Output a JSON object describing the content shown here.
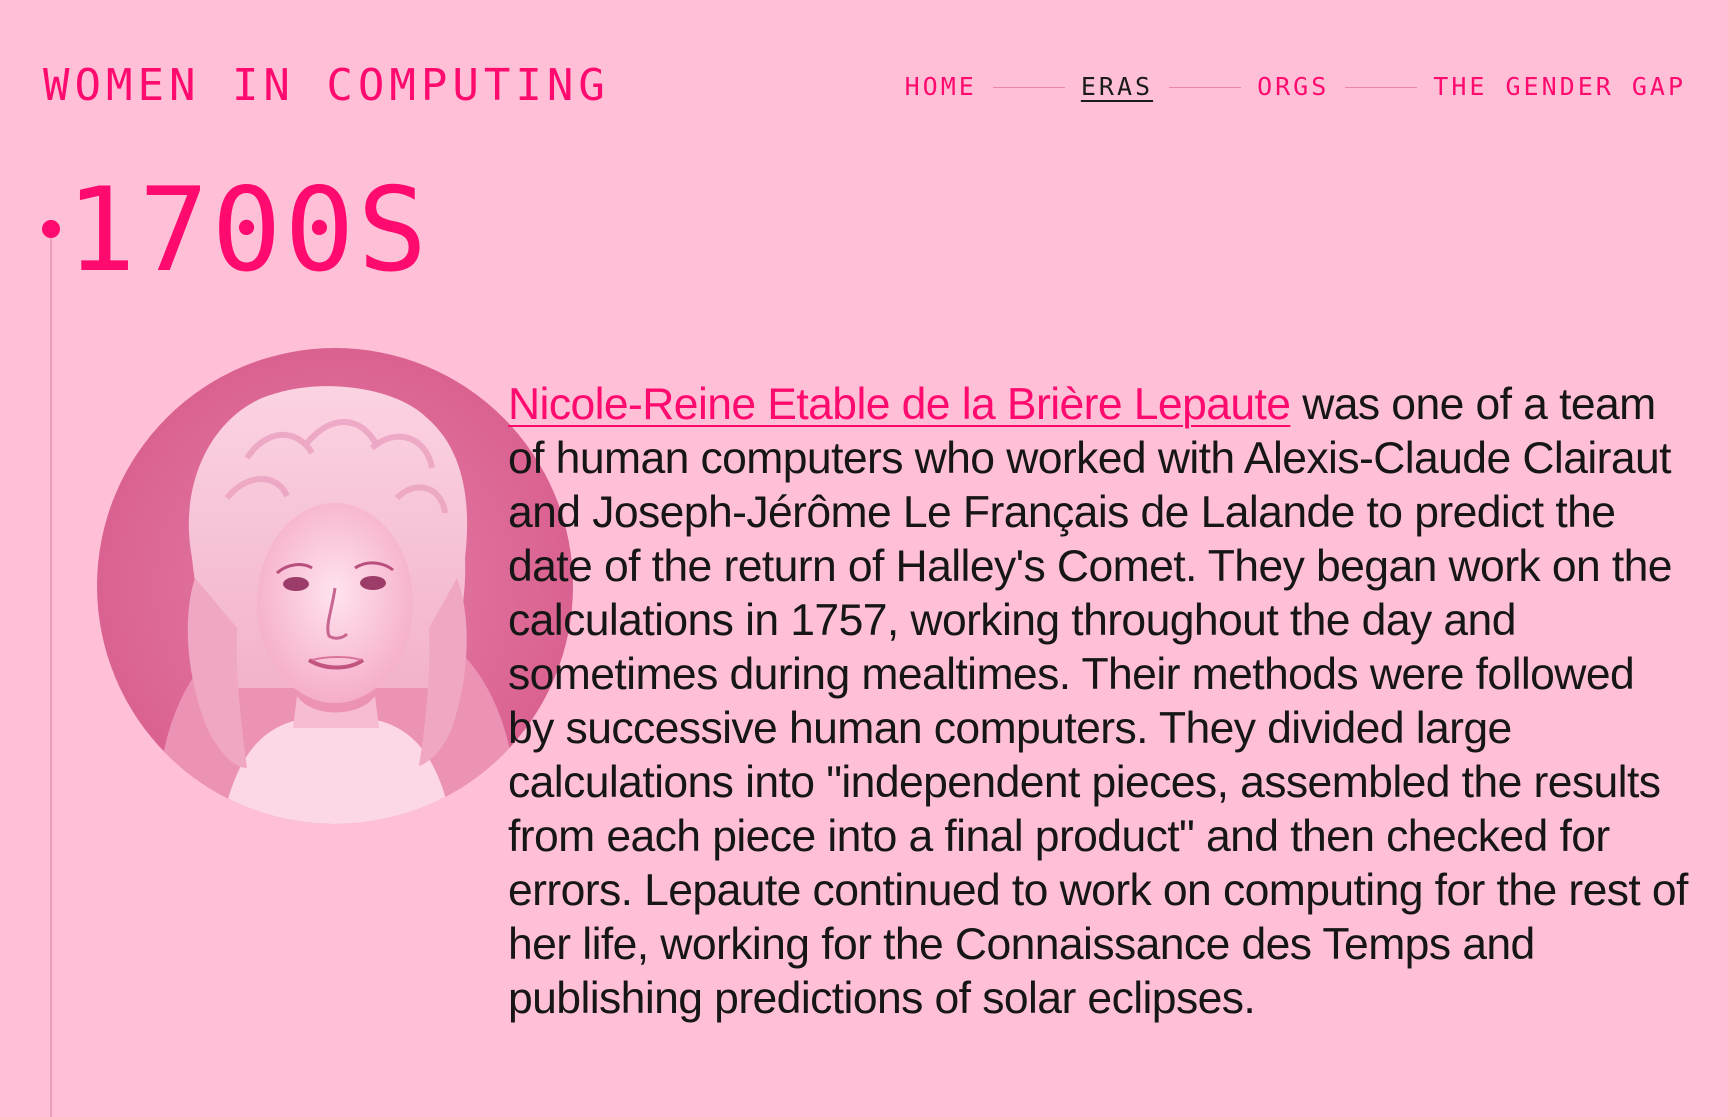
{
  "header": {
    "site_title": "WOMEN IN COMPUTING",
    "nav": [
      {
        "label": "HOME",
        "active": false
      },
      {
        "label": "ERAS",
        "active": true
      },
      {
        "label": "ORGS",
        "active": false
      },
      {
        "label": "THE GENDER GAP",
        "active": false
      }
    ]
  },
  "era": {
    "heading": "1700S"
  },
  "entry": {
    "name_link": "Nicole-Reine Etable de la Brière Lepaute",
    "description": " was one of a team of human computers who worked with Alexis-Claude Clairaut and Joseph-Jérôme Le Français de Lalande to predict the date of the return of Halley's Comet. They began work on the calculations in 1757, working throughout the day and sometimes during mealtimes. Their methods were followed by successive human computers. They divided large calculations into \"independent pieces, assembled the results from each piece into a final product\" and then checked for errors. Lepaute continued to work on computing for the rest of her life, working for the Connaissance des Temps and publishing predictions of solar eclipses."
  },
  "colors": {
    "background": "#ffc0d7",
    "accent": "#ff0a6e",
    "text": "#161616",
    "timeline": "#e9a0bb"
  }
}
